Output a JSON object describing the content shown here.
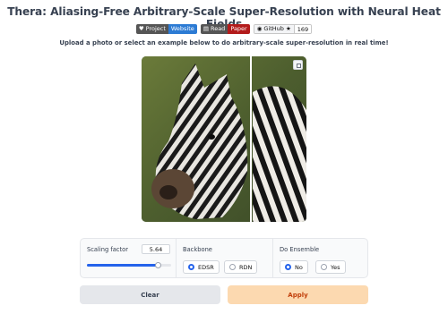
{
  "title": "Thera: Aliasing-Free Arbitrary-Scale Super-Resolution with Neural Heat Fields",
  "badges": {
    "project": {
      "left": "Project",
      "right": "Website"
    },
    "paper": {
      "left": "Read",
      "right": "Paper"
    },
    "github": {
      "left": "GitHub",
      "right": "169"
    }
  },
  "subtitle": "Upload a photo or select an example below to do arbitrary-scale super-resolution in real time!",
  "scaling": {
    "label": "Scaling factor",
    "value": "5.64",
    "fraction": 0.85
  },
  "backbone": {
    "label": "Backbone",
    "options": [
      "EDSR",
      "RDN"
    ],
    "selected": "EDSR"
  },
  "ensemble": {
    "label": "Do Ensemble",
    "options": [
      "No",
      "Yes"
    ],
    "selected": "No"
  },
  "buttons": {
    "clear": "Clear",
    "apply": "Apply"
  },
  "colors": {
    "accent": "#2563eb",
    "apply_bg": "#fcd9b0",
    "apply_text": "#c2410c"
  }
}
